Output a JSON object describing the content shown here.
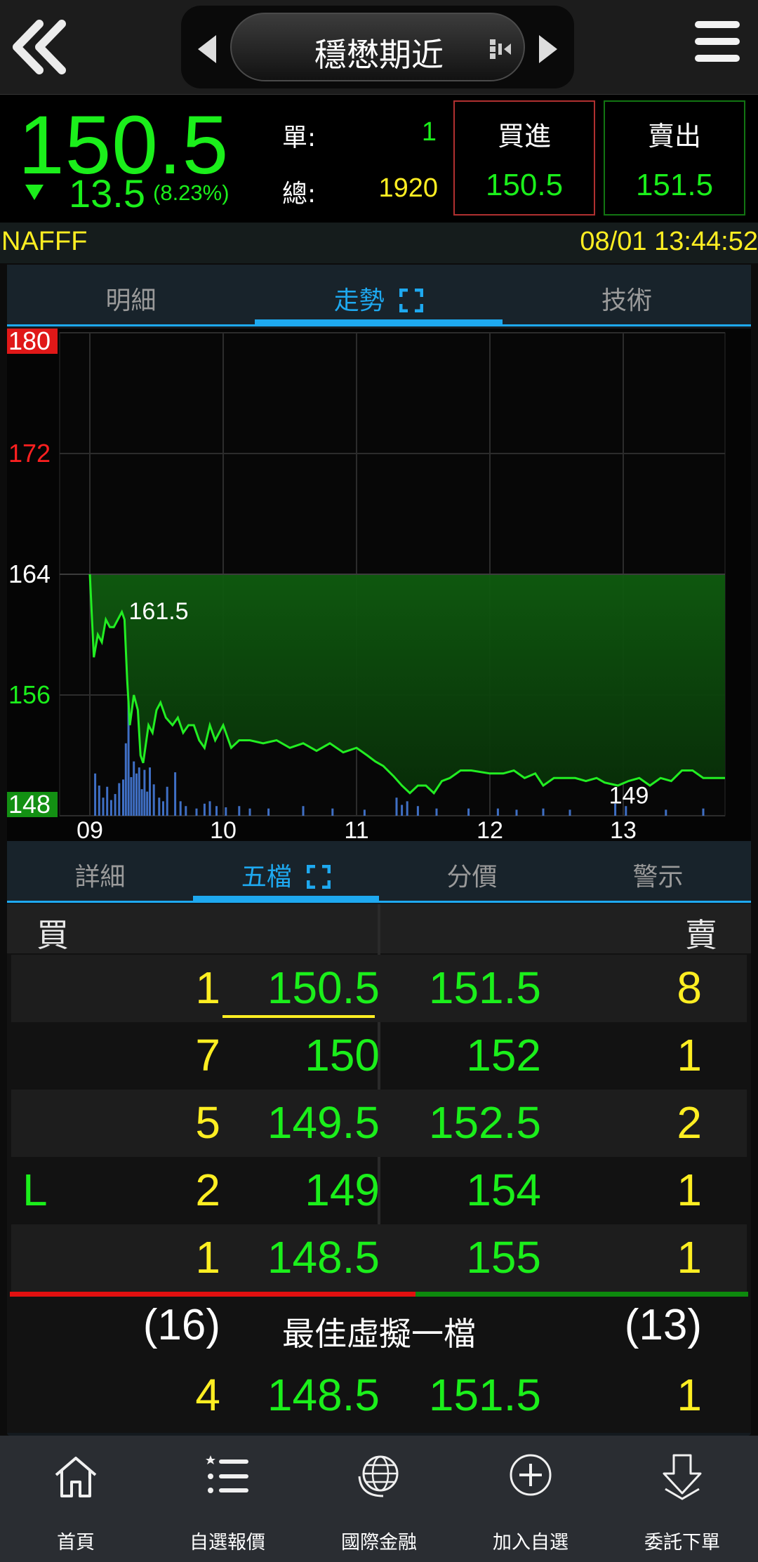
{
  "header": {
    "title": "穩懋期近"
  },
  "quote": {
    "price": "150.5",
    "change": "13.5",
    "change_pct": "(8.23%)",
    "single_label": "單:",
    "single_value": "1",
    "total_label": "總:",
    "total_value": "1920",
    "buy_label": "買進",
    "buy_price": "150.5",
    "sell_label": "賣出",
    "sell_price": "151.5"
  },
  "symbol_bar": {
    "symbol": "NAFFF",
    "datetime": "08/01 13:44:52"
  },
  "top_tabs": [
    "明細",
    "走勢",
    "技術"
  ],
  "bottom_tabs": [
    "詳細",
    "五檔",
    "分價",
    "警示"
  ],
  "chart_data": {
    "type": "area",
    "y_ticks": [
      "180",
      "172",
      "164",
      "156",
      "148"
    ],
    "x_ticks": [
      "09",
      "10",
      "11",
      "12",
      "13"
    ],
    "ylim": [
      148,
      180
    ],
    "reference_price": 164,
    "annotations": [
      {
        "text": "161.5",
        "x": 0.25,
        "y": 161.5
      },
      {
        "text": "149",
        "x": 4.0,
        "y": 149
      }
    ],
    "line_color": "#22ee22",
    "fill_above_color": "#0f5a0f",
    "price_series": [
      [
        0.0,
        164
      ],
      [
        0.03,
        158.5
      ],
      [
        0.06,
        160
      ],
      [
        0.09,
        159.5
      ],
      [
        0.12,
        161
      ],
      [
        0.15,
        160.5
      ],
      [
        0.18,
        160.5
      ],
      [
        0.21,
        161
      ],
      [
        0.24,
        161.5
      ],
      [
        0.26,
        161
      ],
      [
        0.28,
        157
      ],
      [
        0.3,
        154
      ],
      [
        0.33,
        156
      ],
      [
        0.36,
        155
      ],
      [
        0.38,
        152
      ],
      [
        0.4,
        151.5
      ],
      [
        0.44,
        154
      ],
      [
        0.47,
        153.5
      ],
      [
        0.5,
        155
      ],
      [
        0.53,
        155.5
      ],
      [
        0.57,
        154.5
      ],
      [
        0.62,
        154
      ],
      [
        0.66,
        154.5
      ],
      [
        0.7,
        153.5
      ],
      [
        0.74,
        154
      ],
      [
        0.78,
        154
      ],
      [
        0.82,
        153
      ],
      [
        0.86,
        152.5
      ],
      [
        0.9,
        154
      ],
      [
        0.94,
        153
      ],
      [
        1.0,
        154
      ],
      [
        1.06,
        152.5
      ],
      [
        1.12,
        153
      ],
      [
        1.2,
        153
      ],
      [
        1.3,
        152.8
      ],
      [
        1.4,
        153
      ],
      [
        1.5,
        152.5
      ],
      [
        1.6,
        152.8
      ],
      [
        1.7,
        152.3
      ],
      [
        1.8,
        152.8
      ],
      [
        1.9,
        152.2
      ],
      [
        2.0,
        152.5
      ],
      [
        2.08,
        152
      ],
      [
        2.14,
        151.6
      ],
      [
        2.2,
        151.3
      ],
      [
        2.28,
        150.6
      ],
      [
        2.34,
        150
      ],
      [
        2.4,
        149.5
      ],
      [
        2.46,
        150
      ],
      [
        2.52,
        150
      ],
      [
        2.58,
        149.5
      ],
      [
        2.64,
        150.3
      ],
      [
        2.7,
        150.5
      ],
      [
        2.78,
        151
      ],
      [
        2.86,
        151
      ],
      [
        3.0,
        150.8
      ],
      [
        3.1,
        150.8
      ],
      [
        3.18,
        151
      ],
      [
        3.26,
        150.5
      ],
      [
        3.34,
        150.8
      ],
      [
        3.4,
        150
      ],
      [
        3.48,
        150.5
      ],
      [
        3.56,
        150.5
      ],
      [
        3.64,
        150.5
      ],
      [
        3.72,
        150.3
      ],
      [
        3.8,
        150.5
      ],
      [
        3.86,
        150.2
      ],
      [
        3.96,
        150
      ],
      [
        4.04,
        150.3
      ],
      [
        4.12,
        150.5
      ],
      [
        4.2,
        150
      ],
      [
        4.28,
        150.5
      ],
      [
        4.36,
        150.3
      ],
      [
        4.44,
        151
      ],
      [
        4.52,
        151
      ],
      [
        4.6,
        150.5
      ],
      [
        4.68,
        150.5
      ],
      [
        4.74,
        150.5
      ]
    ],
    "volume_series": [
      [
        0.04,
        3.5
      ],
      [
        0.07,
        2.5
      ],
      [
        0.1,
        1.5
      ],
      [
        0.13,
        2.4
      ],
      [
        0.16,
        1.3
      ],
      [
        0.19,
        1.8
      ],
      [
        0.22,
        2.7
      ],
      [
        0.25,
        3.0
      ],
      [
        0.27,
        6.0
      ],
      [
        0.29,
        9.5
      ],
      [
        0.31,
        3.2
      ],
      [
        0.33,
        4.5
      ],
      [
        0.35,
        3.5
      ],
      [
        0.37,
        4.0
      ],
      [
        0.39,
        2.2
      ],
      [
        0.41,
        3.8
      ],
      [
        0.43,
        2.0
      ],
      [
        0.45,
        4.0
      ],
      [
        0.48,
        2.6
      ],
      [
        0.52,
        1.5
      ],
      [
        0.55,
        1.2
      ],
      [
        0.58,
        2.4
      ],
      [
        0.64,
        3.6
      ],
      [
        0.68,
        1.2
      ],
      [
        0.72,
        0.8
      ],
      [
        0.8,
        0.6
      ],
      [
        0.86,
        1.0
      ],
      [
        0.9,
        1.2
      ],
      [
        0.95,
        0.8
      ],
      [
        1.02,
        0.7
      ],
      [
        1.12,
        0.8
      ],
      [
        1.2,
        0.6
      ],
      [
        1.34,
        0.6
      ],
      [
        1.6,
        0.8
      ],
      [
        1.82,
        0.6
      ],
      [
        2.06,
        0.5
      ],
      [
        2.3,
        1.5
      ],
      [
        2.34,
        0.9
      ],
      [
        2.38,
        1.2
      ],
      [
        2.46,
        0.8
      ],
      [
        2.6,
        0.6
      ],
      [
        2.84,
        0.6
      ],
      [
        3.06,
        0.6
      ],
      [
        3.2,
        0.5
      ],
      [
        3.4,
        0.6
      ],
      [
        3.6,
        0.5
      ],
      [
        3.94,
        1.0
      ],
      [
        4.02,
        0.8
      ],
      [
        4.32,
        0.5
      ],
      [
        4.6,
        0.6
      ]
    ],
    "volume_max": 12
  },
  "orderbook": {
    "bid_header": "買",
    "ask_header": "賣",
    "rows": [
      {
        "flag": "",
        "bid_qty": "1",
        "bid_price": "150.5",
        "ask_price": "151.5",
        "ask_qty": "8"
      },
      {
        "flag": "",
        "bid_qty": "7",
        "bid_price": "150",
        "ask_price": "152",
        "ask_qty": "1"
      },
      {
        "flag": "",
        "bid_qty": "5",
        "bid_price": "149.5",
        "ask_price": "152.5",
        "ask_qty": "2"
      },
      {
        "flag": "L",
        "bid_qty": "2",
        "bid_price": "149",
        "ask_price": "154",
        "ask_qty": "1"
      },
      {
        "flag": "",
        "bid_qty": "1",
        "bid_price": "148.5",
        "ask_price": "155",
        "ask_qty": "1"
      }
    ],
    "bid_total": "(16)",
    "ask_total": "(13)",
    "virtual_label": "最佳虛擬一檔",
    "virtual": {
      "bid_qty": "4",
      "bid_price": "148.5",
      "ask_price": "151.5",
      "ask_qty": "1"
    }
  },
  "nav": [
    {
      "label": "首頁",
      "icon": "home-icon"
    },
    {
      "label": "自選報價",
      "icon": "watchlist-icon"
    },
    {
      "label": "國際金融",
      "icon": "globe-icon"
    },
    {
      "label": "加入自選",
      "icon": "add-circle-icon"
    },
    {
      "label": "委託下單",
      "icon": "order-arrow-icon"
    }
  ]
}
